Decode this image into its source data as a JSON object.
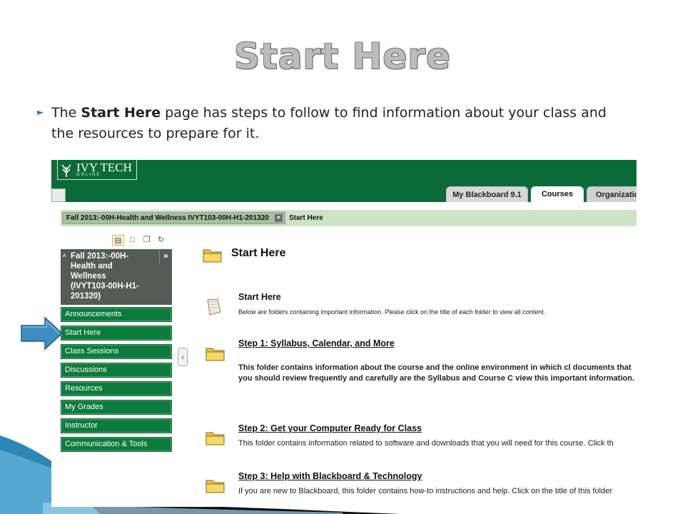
{
  "slide": {
    "title": "Start Here",
    "bullet_pre": "The ",
    "bullet_bold": "Start Here",
    "bullet_post": " page has steps to follow to find information about your class and the resources to prepare for it."
  },
  "header": {
    "logo_text": "IVY TECH",
    "logo_sub": "ONLINE",
    "tabs": [
      {
        "label": "My Blackboard 9.1"
      },
      {
        "label": "Courses"
      },
      {
        "label": "Organization"
      }
    ]
  },
  "breadcrumb": {
    "course": "Fall 2013:-00H-Health and Wellness IVYT103-00H-H1-201320",
    "current": "Start Here"
  },
  "course_menu": {
    "title_lines": [
      "Fall 2013:-00H-",
      "Health and",
      "Wellness",
      "(IVYT103-00H-H1-",
      "201320)"
    ],
    "items": [
      {
        "label": "Announcements"
      },
      {
        "label": "Start Here"
      },
      {
        "label": "Class Sessions"
      },
      {
        "label": "Discussions"
      },
      {
        "label": "Resources"
      },
      {
        "label": "My Grades"
      },
      {
        "label": "Instructor"
      },
      {
        "label": "Communication & Tools"
      }
    ]
  },
  "content": {
    "page_title": "Start Here",
    "items": [
      {
        "title": "Start Here",
        "desc": "Below are folders containing important information. Please click on the title of each folder to view all content."
      },
      {
        "title": "Step 1: Syllabus, Calendar, and More",
        "desc": "This folder contains information about the course and the online environment in which cl documents that you should review frequently and carefully are the Syllabus and Course C view this important information."
      },
      {
        "title": "Step 2: Get your Computer Ready for Class",
        "desc": "This folder contains information related to software and downloads that you will need for this course. Click th"
      },
      {
        "title": "Step 3: Help with Blackboard & Technology",
        "desc": "If you are new to Blackboard, this folder contains how-to instructions and help. Click on the title of this folder"
      }
    ]
  },
  "colors": {
    "header_green": "#0b6b38",
    "nav_green": "#0d7a3e",
    "crumb_bg": "#cfe4c6",
    "arrow_blue": "#3e8fc0"
  }
}
